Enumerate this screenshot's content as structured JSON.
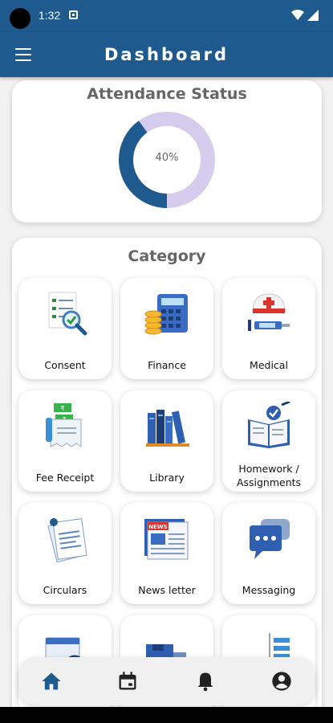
{
  "status_bar": {
    "time": "1:32"
  },
  "app_bar": {
    "title": "Dashboard"
  },
  "attendance": {
    "title": "Attendance Status",
    "percent_label": "40%",
    "percent": 40
  },
  "category": {
    "title": "Category",
    "items": [
      {
        "label": "Consent",
        "icon": "consent-icon"
      },
      {
        "label": "Finance",
        "icon": "finance-icon"
      },
      {
        "label": "Medical",
        "icon": "medical-icon"
      },
      {
        "label": "Fee Receipt",
        "icon": "fee-receipt-icon"
      },
      {
        "label": "Library",
        "icon": "library-icon"
      },
      {
        "label": "Homework / Assignments",
        "icon": "homework-icon"
      },
      {
        "label": "Circulars",
        "icon": "circulars-icon"
      },
      {
        "label": "News letter",
        "icon": "newsletter-icon"
      },
      {
        "label": "Messaging",
        "icon": "messaging-icon"
      }
    ]
  },
  "bottom_nav": [
    "home-icon",
    "calendar-icon",
    "bell-icon",
    "profile-icon"
  ],
  "colors": {
    "primary": "#1e5a8e",
    "donut_track": "#d6cdee",
    "donut_fill": "#1e5a8e"
  }
}
